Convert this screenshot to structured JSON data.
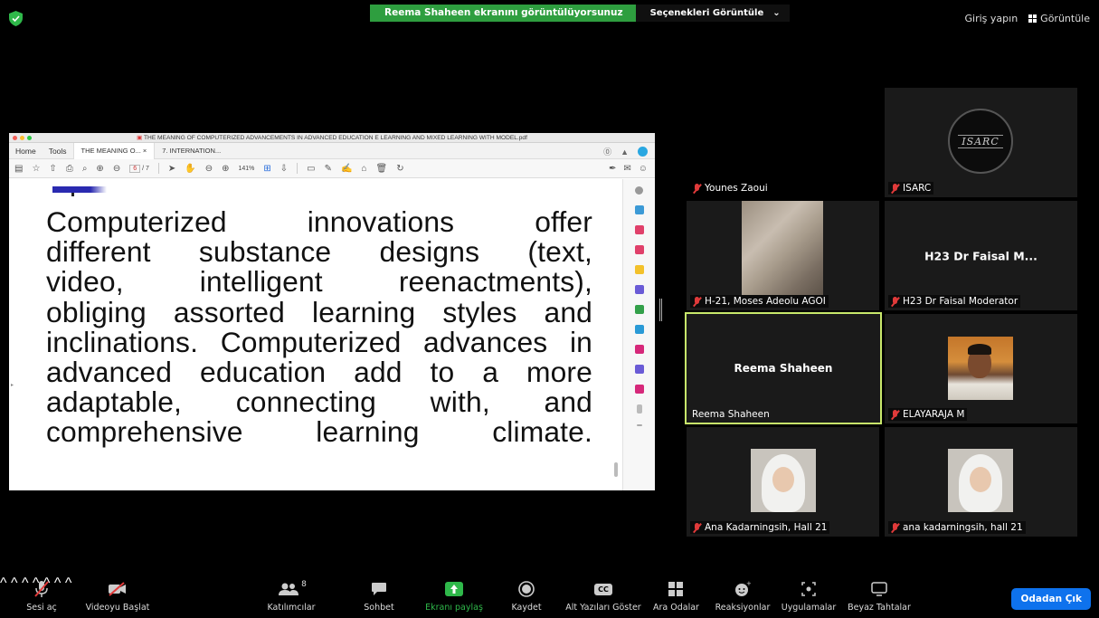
{
  "top": {
    "sharing_banner": "Reema Shaheen ekranını görüntülüyorsunuz",
    "view_options": "Seçenekleri Görüntüle",
    "sign_in": "Giriş yapın",
    "view": "Görüntüle"
  },
  "pdf": {
    "window_title": "THE MEANING OF COMPUTERIZED ADVANCEMENTS IN ADVANCED EDUCATION E LEARNING AND MIXED LEARNING WITH MODEL.pdf",
    "menu_home": "Home",
    "menu_tools": "Tools",
    "tab1": "THE MEANING O...",
    "tab1_close": "×",
    "tab2": "7. INTERNATION...",
    "page_current": "6",
    "page_total": "/ 7",
    "zoom": "141%",
    "lines": [
      "Computerized innovations offer",
      "different substance designs (text,",
      "video, intelligent reenactments),",
      "obliging assorted learning styles and",
      "inclinations. Computerized advances in",
      "advanced education add to a more",
      "adaptable, connecting with, and",
      "comprehensive learning climate."
    ]
  },
  "gallery": [
    {
      "name": "Younes Zaoui",
      "type": "video-dark"
    },
    {
      "name": "ISARC",
      "type": "logo",
      "logo_text": "ISARC"
    },
    {
      "name": "H-21, Moses Adeolu AGOI",
      "type": "video-room"
    },
    {
      "name": "H23 Dr Faisal Moderator",
      "type": "text",
      "center": "H23 Dr Faisal M..."
    },
    {
      "name": "Reema Shaheen",
      "type": "text",
      "center": "Reema Shaheen"
    },
    {
      "name": "ELAYARAJA M",
      "type": "photo"
    },
    {
      "name": "Ana Kadarningsih, Hall 21",
      "type": "photo"
    },
    {
      "name": "ana kadarningsih, hall 21",
      "type": "photo"
    }
  ],
  "bottom": {
    "unmute": "Sesi aç",
    "start_video": "Videoyu Başlat",
    "participants": "Katılımcılar",
    "participants_count": "8",
    "chat": "Sohbet",
    "share": "Ekranı paylaş",
    "record": "Kaydet",
    "captions": "Alt Yazıları Göster",
    "captions_icon": "CC",
    "breakout": "Ara Odalar",
    "reactions": "Reaksiyonlar",
    "apps": "Uygulamalar",
    "whiteboard": "Beyaz Tahtalar",
    "leave": "Odadan Çık"
  },
  "colors": {
    "banner_green": "#2e9e3f",
    "leave_blue": "#0e72ed",
    "active_speaker": "#c8e86b",
    "muted_red": "#e03a3a"
  }
}
